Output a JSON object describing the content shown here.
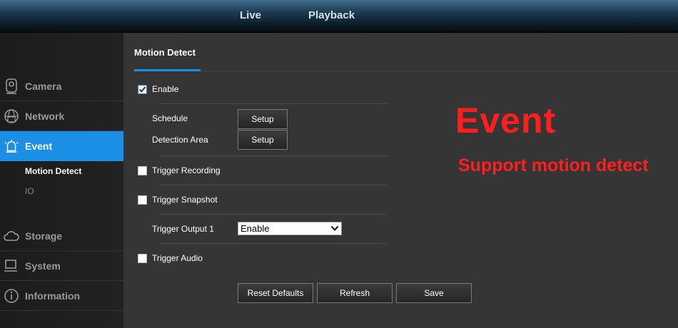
{
  "topnav": {
    "live": "Live",
    "playback": "Playback"
  },
  "sidebar": {
    "items": [
      {
        "label": "Camera",
        "icon": "camera-icon"
      },
      {
        "label": "Network",
        "icon": "network-icon"
      },
      {
        "label": "Event",
        "icon": "alarm-icon",
        "active": true
      },
      {
        "label": "Storage",
        "icon": "cloud-icon"
      },
      {
        "label": "System",
        "icon": "computer-icon"
      },
      {
        "label": "Information",
        "icon": "info-icon"
      }
    ],
    "sub_items": [
      {
        "label": "Motion Detect",
        "active": true
      },
      {
        "label": "IO",
        "active": false
      }
    ]
  },
  "main": {
    "tab_title": "Motion Detect",
    "enable": {
      "label": "Enable",
      "checked": true
    },
    "schedule": {
      "label": "Schedule",
      "button": "Setup"
    },
    "detection_area": {
      "label": "Detection Area",
      "button": "Setup"
    },
    "trigger_recording": {
      "label": "Trigger Recording",
      "checked": false
    },
    "trigger_snapshot": {
      "label": "Trigger Snapshot",
      "checked": false
    },
    "trigger_output": {
      "label": "Trigger Output 1",
      "value": "Enable"
    },
    "trigger_audio": {
      "label": "Trigger Audio",
      "checked": false
    },
    "buttons": {
      "reset": "Reset Defaults",
      "refresh": "Refresh",
      "save": "Save"
    }
  },
  "promo": {
    "title": "Event",
    "subtitle": "Support motion detect"
  },
  "colors": {
    "accent": "#1b8fe6",
    "promo": "#ff1f1f",
    "panel": "#353535",
    "sidebar": "#1c1c1c"
  }
}
